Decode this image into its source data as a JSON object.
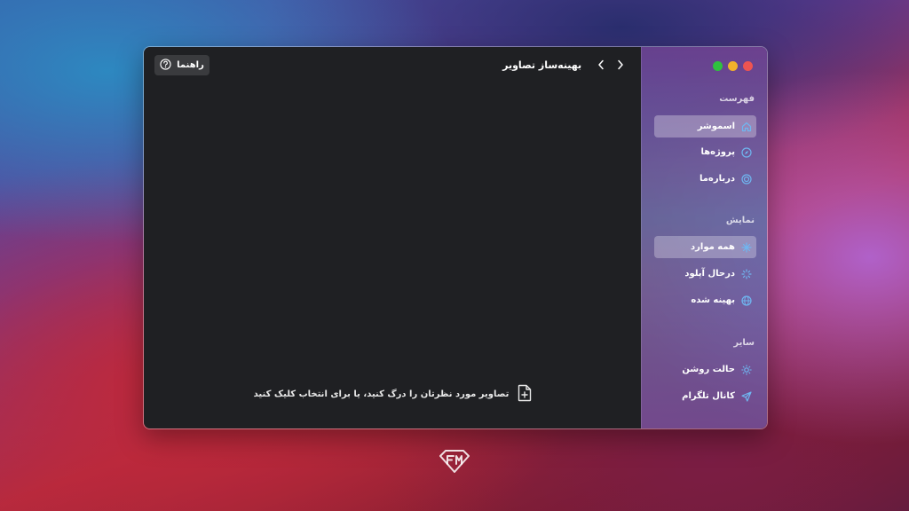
{
  "header": {
    "title": "بهینه‌ساز تصاویر",
    "help_label": "راهنما"
  },
  "dropzone": {
    "text": "تصاویر مورد نظرتان را درگ کنید، یا برای انتخاب کلیک کنید"
  },
  "sidebar": {
    "traffic_lights": [
      "#ef5451",
      "#f1b12b",
      "#2fc13f"
    ],
    "sections": [
      {
        "title": "فهرست",
        "items": [
          {
            "label": "اسموشر",
            "icon": "home-icon",
            "active": true
          },
          {
            "label": "پروژه‌ها",
            "icon": "compass-icon",
            "active": false
          },
          {
            "label": "درباره‌ما",
            "icon": "target-icon",
            "active": false
          }
        ]
      },
      {
        "title": "نمایش",
        "items": [
          {
            "label": "همه موارد",
            "icon": "grid-icon",
            "active": true
          },
          {
            "label": "درحال آپلود",
            "icon": "loader-icon",
            "active": false
          },
          {
            "label": "بهینه شده",
            "icon": "globe-icon",
            "active": false
          }
        ]
      },
      {
        "title": "سایر",
        "items": [
          {
            "label": "حالت روشن",
            "icon": "sun-icon",
            "active": false
          },
          {
            "label": "کانال تلگرام",
            "icon": "send-icon",
            "active": false
          }
        ]
      }
    ]
  },
  "colors": {
    "accent": "#5aa8e6",
    "main_bg": "#1f2023"
  }
}
